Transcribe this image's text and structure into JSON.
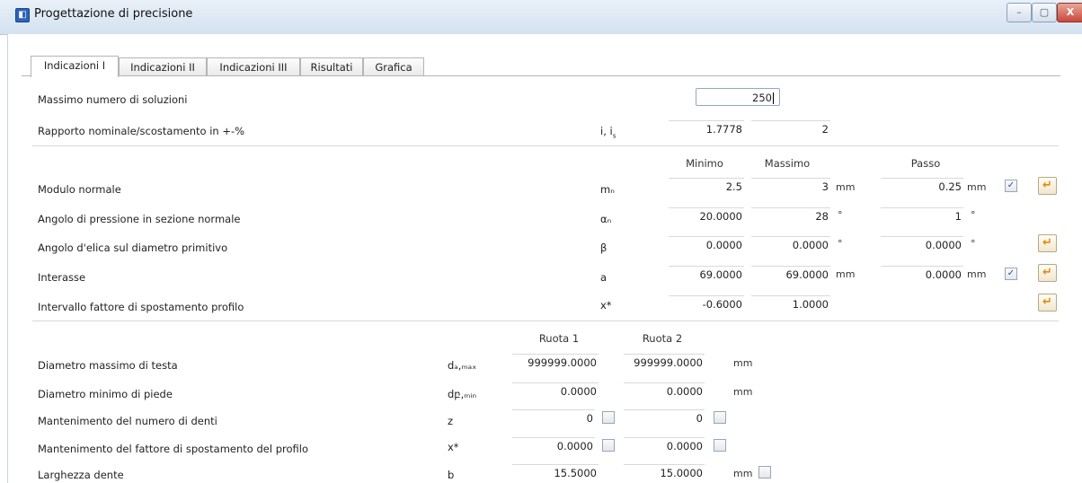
{
  "window": {
    "title": "Progettazione di precisione",
    "minimize": "–",
    "maximize": "▢",
    "close": "X"
  },
  "tabs": [
    "Indicazioni I",
    "Indicazioni II",
    "Indicazioni III",
    "Risultati",
    "Grafica"
  ],
  "active_tab": "Indicazioni I",
  "section1": {
    "max_solutions_label": "Massimo numero di soluzioni",
    "max_solutions_value": "250",
    "ratio_label": "Rapporto nominale/scostamento in +-%",
    "ratio_symbol": "i, i",
    "ratio_value": "1.7778",
    "ratio_deviation": "2"
  },
  "section2": {
    "col_min": "Minimo",
    "col_max": "Massimo",
    "col_step": "Passo",
    "rows": [
      {
        "label": "Modulo normale",
        "symbol": "mₙ",
        "min": "2.5",
        "max": "3",
        "max_unit": "mm",
        "step": "0.25",
        "step_unit": "mm",
        "checked": "✓"
      },
      {
        "label": "Angolo di pressione in sezione normale",
        "symbol": "αₙ",
        "min": "20.0000",
        "max": "28",
        "max_unit": "°",
        "step": "1",
        "step_unit": "°"
      },
      {
        "label": "Angolo d'elica sul diametro primitivo",
        "symbol": "β",
        "min": "0.0000",
        "max": "0.0000",
        "max_unit": "°",
        "step": "0.0000",
        "step_unit": "°"
      },
      {
        "label": "Interasse",
        "symbol": "a",
        "min": "69.0000",
        "max": "69.0000",
        "max_unit": "mm",
        "step": "0.0000",
        "step_unit": "mm",
        "checked": "✓"
      },
      {
        "label": "Intervallo fattore di spostamento profilo",
        "symbol": "x*",
        "min": "-0.6000",
        "max": "1.0000"
      }
    ]
  },
  "section3": {
    "col_wheel1": "Ruota 1",
    "col_wheel2": "Ruota 2",
    "rows": [
      {
        "label": "Diametro massimo di testa",
        "symbol": "dₐ,ₘₐₓ",
        "w1": "999999.0000",
        "w2": "999999.0000",
        "unit": "mm"
      },
      {
        "label": "Diametro minimo di piede",
        "symbol": "dբ,ₘᵢₙ",
        "w1": "0.0000",
        "w2": "0.0000",
        "unit": "mm"
      },
      {
        "label": "Mantenimento del numero di denti",
        "symbol": "z",
        "w1": "0",
        "w2": "0"
      },
      {
        "label": "Mantenimento del fattore di spostamento del profilo",
        "symbol": "x*",
        "w1": "0.0000",
        "w2": "0.0000"
      },
      {
        "label": "Larghezza dente",
        "symbol": "b",
        "w1": "15.5000",
        "w2": "15.0000",
        "unit": "mm"
      }
    ]
  },
  "icons": {
    "apply": "arrow-left-icon",
    "app": "app-icon"
  }
}
